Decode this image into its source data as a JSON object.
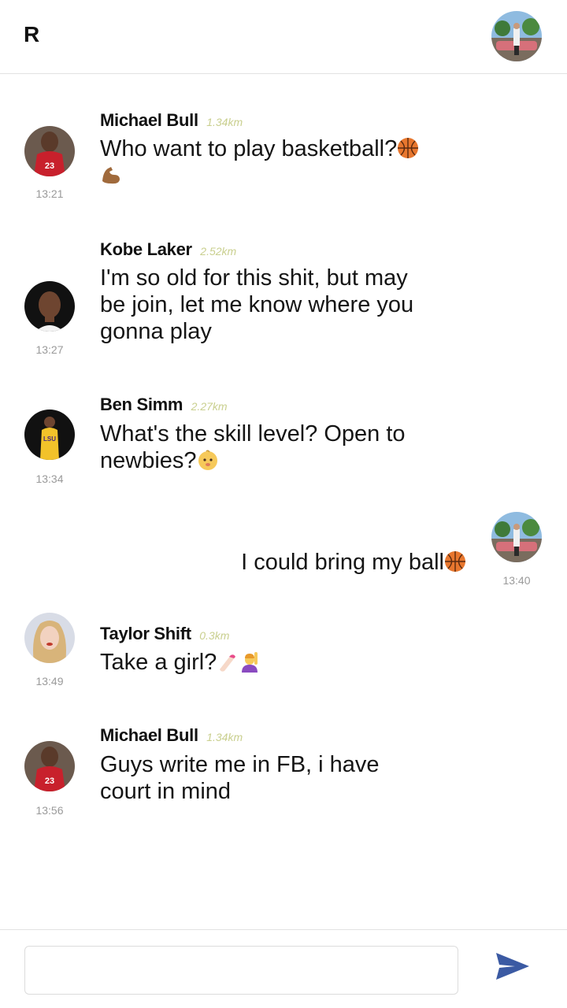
{
  "header": {
    "logo": "R",
    "avatar_icon": "profile-photo-icon"
  },
  "messages": [
    {
      "name": "Michael Bull",
      "distance": "1.34km",
      "text": "Who want to play basketball?",
      "emojis": [
        "basketball-emoji",
        "flexed-biceps-emoji"
      ],
      "time": "13:21",
      "avatar": "jordan-avatar"
    },
    {
      "name": "Kobe Laker",
      "distance": "2.52km",
      "text": "I'm so old for this shit, but may be join, let me know where you gonna play",
      "emojis": [],
      "time": "13:27",
      "avatar": "kobe-avatar"
    },
    {
      "name": "Ben Simm",
      "distance": "2.27km",
      "text": "What's the skill level? Open to newbies?",
      "emojis": [
        "baby-emoji"
      ],
      "time": "13:34",
      "avatar": "simmons-avatar"
    },
    {
      "own": true,
      "text": "I could bring my ball",
      "emojis": [
        "basketball-emoji"
      ],
      "time": "13:40",
      "avatar": "me-avatar"
    },
    {
      "name": "Taylor Shift",
      "distance": "0.3km",
      "text": "Take a girl?",
      "emojis": [
        "nail-polish-emoji",
        "person-raising-hand-emoji"
      ],
      "time": "13:49",
      "avatar": "taylor-avatar"
    },
    {
      "name": "Michael Bull",
      "distance": "1.34km",
      "text": "Guys write me in FB, i have court in mind",
      "emojis": [],
      "time": "13:56",
      "avatar": "jordan-avatar"
    }
  ],
  "composer": {
    "placeholder": "",
    "value": "",
    "send_icon": "send-icon"
  },
  "colors": {
    "distance": "#c9cf8e",
    "time": "#9a9a9a",
    "send": "#3b5aa3",
    "divider": "#e2e2e2"
  }
}
